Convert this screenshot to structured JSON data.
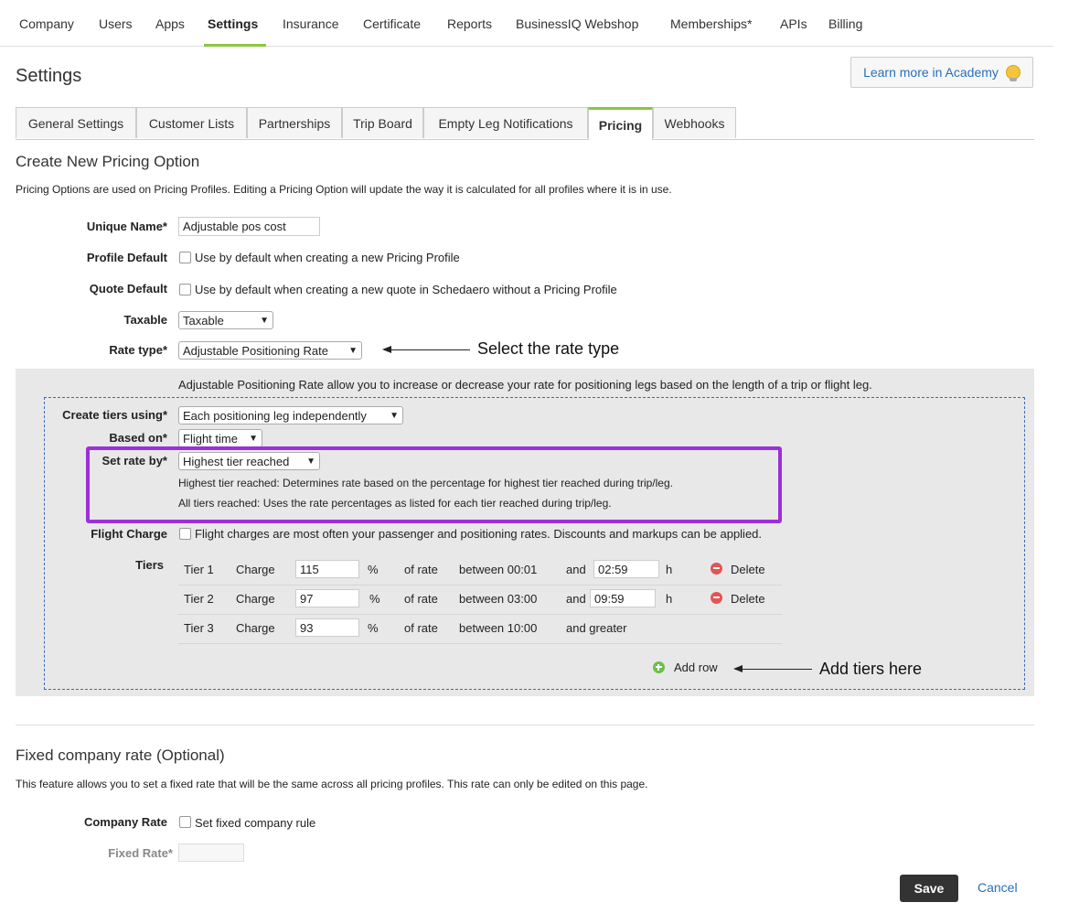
{
  "topnav": {
    "items": [
      "Company",
      "Users",
      "Apps",
      "Settings",
      "Insurance",
      "Certificate",
      "Reports",
      "BusinessIQ Webshop",
      "Memberships*",
      "APIs",
      "Billing"
    ],
    "active": "Settings"
  },
  "page": {
    "title": "Settings",
    "academy_button": "Learn more in Academy"
  },
  "tabs": [
    "General Settings",
    "Customer Lists",
    "Partnerships",
    "Trip Board",
    "Empty Leg Notifications",
    "Pricing",
    "Webhooks"
  ],
  "create": {
    "heading": "Create New Pricing Option",
    "description": "Pricing Options are used on Pricing Profiles. Editing a Pricing Option will update the way it is calculated for all profiles where it is in use.",
    "unique_name_label": "Unique Name*",
    "unique_name_value": "Adjustable pos cost",
    "profile_default_label": "Profile Default",
    "profile_default_text": "Use by default when creating a new Pricing Profile",
    "quote_default_label": "Quote Default",
    "quote_default_text": "Use by default when creating a new quote in Schedaero without a Pricing Profile",
    "taxable_label": "Taxable",
    "taxable_value": "Taxable",
    "rate_type_label": "Rate type*",
    "rate_type_value": "Adjustable Positioning Rate",
    "rate_type_annotation": "Select the rate type",
    "rate_type_description": "Adjustable Positioning Rate allow you to increase or decrease your rate for positioning legs based on the length of a trip or flight leg.",
    "create_tiers_label": "Create tiers using*",
    "create_tiers_value": "Each positioning leg independently",
    "based_on_label": "Based on*",
    "based_on_value": "Flight time",
    "set_rate_label": "Set rate by*",
    "set_rate_value": "Highest tier reached",
    "set_rate_help1": "Highest tier reached: Determines rate based on the percentage for highest tier reached during trip/leg.",
    "set_rate_help2": "All tiers reached: Uses the rate percentages as listed for each tier reached during trip/leg.",
    "flight_charge_label": "Flight Charge",
    "flight_charge_text": "Flight charges are most often your passenger and positioning rates. Discounts and markups can be applied.",
    "tiers_label": "Tiers",
    "tiers": [
      {
        "tier": "Tier  1",
        "charge": "Charge",
        "pct": "115",
        "pct_sym": "%",
        "of_rate": "of rate",
        "between": "between 00:01",
        "and": "and",
        "end": "02:59",
        "h": "h",
        "delete": "Delete"
      },
      {
        "tier": "Tier  2",
        "charge": "Charge",
        "pct": "97",
        "pct_sym": "%",
        "of_rate": "of rate",
        "between": "between 03:00",
        "and": "and",
        "end": "09:59",
        "h": "h",
        "delete": "Delete"
      },
      {
        "tier": "Tier  3",
        "charge": "Charge",
        "pct": "93",
        "pct_sym": "%",
        "of_rate": "of rate",
        "between": "between 10:00",
        "and_greater": "and greater"
      }
    ],
    "add_row": "Add row",
    "add_row_annotation": "Add tiers here"
  },
  "fixed": {
    "heading": "Fixed company rate (Optional)",
    "description": "This feature allows you to set a fixed rate that will be the same across all pricing profiles. This rate can only be edited on this page.",
    "company_rate_label": "Company Rate",
    "company_rate_text": "Set fixed company rule",
    "fixed_rate_label": "Fixed Rate*",
    "fixed_rate_value": ""
  },
  "actions": {
    "save": "Save",
    "cancel": "Cancel"
  },
  "colors": {
    "accent": "#8cc63f",
    "highlight": "#9b30d9",
    "panel_border": "#3a6cb5",
    "link": "#2a6ebb"
  }
}
